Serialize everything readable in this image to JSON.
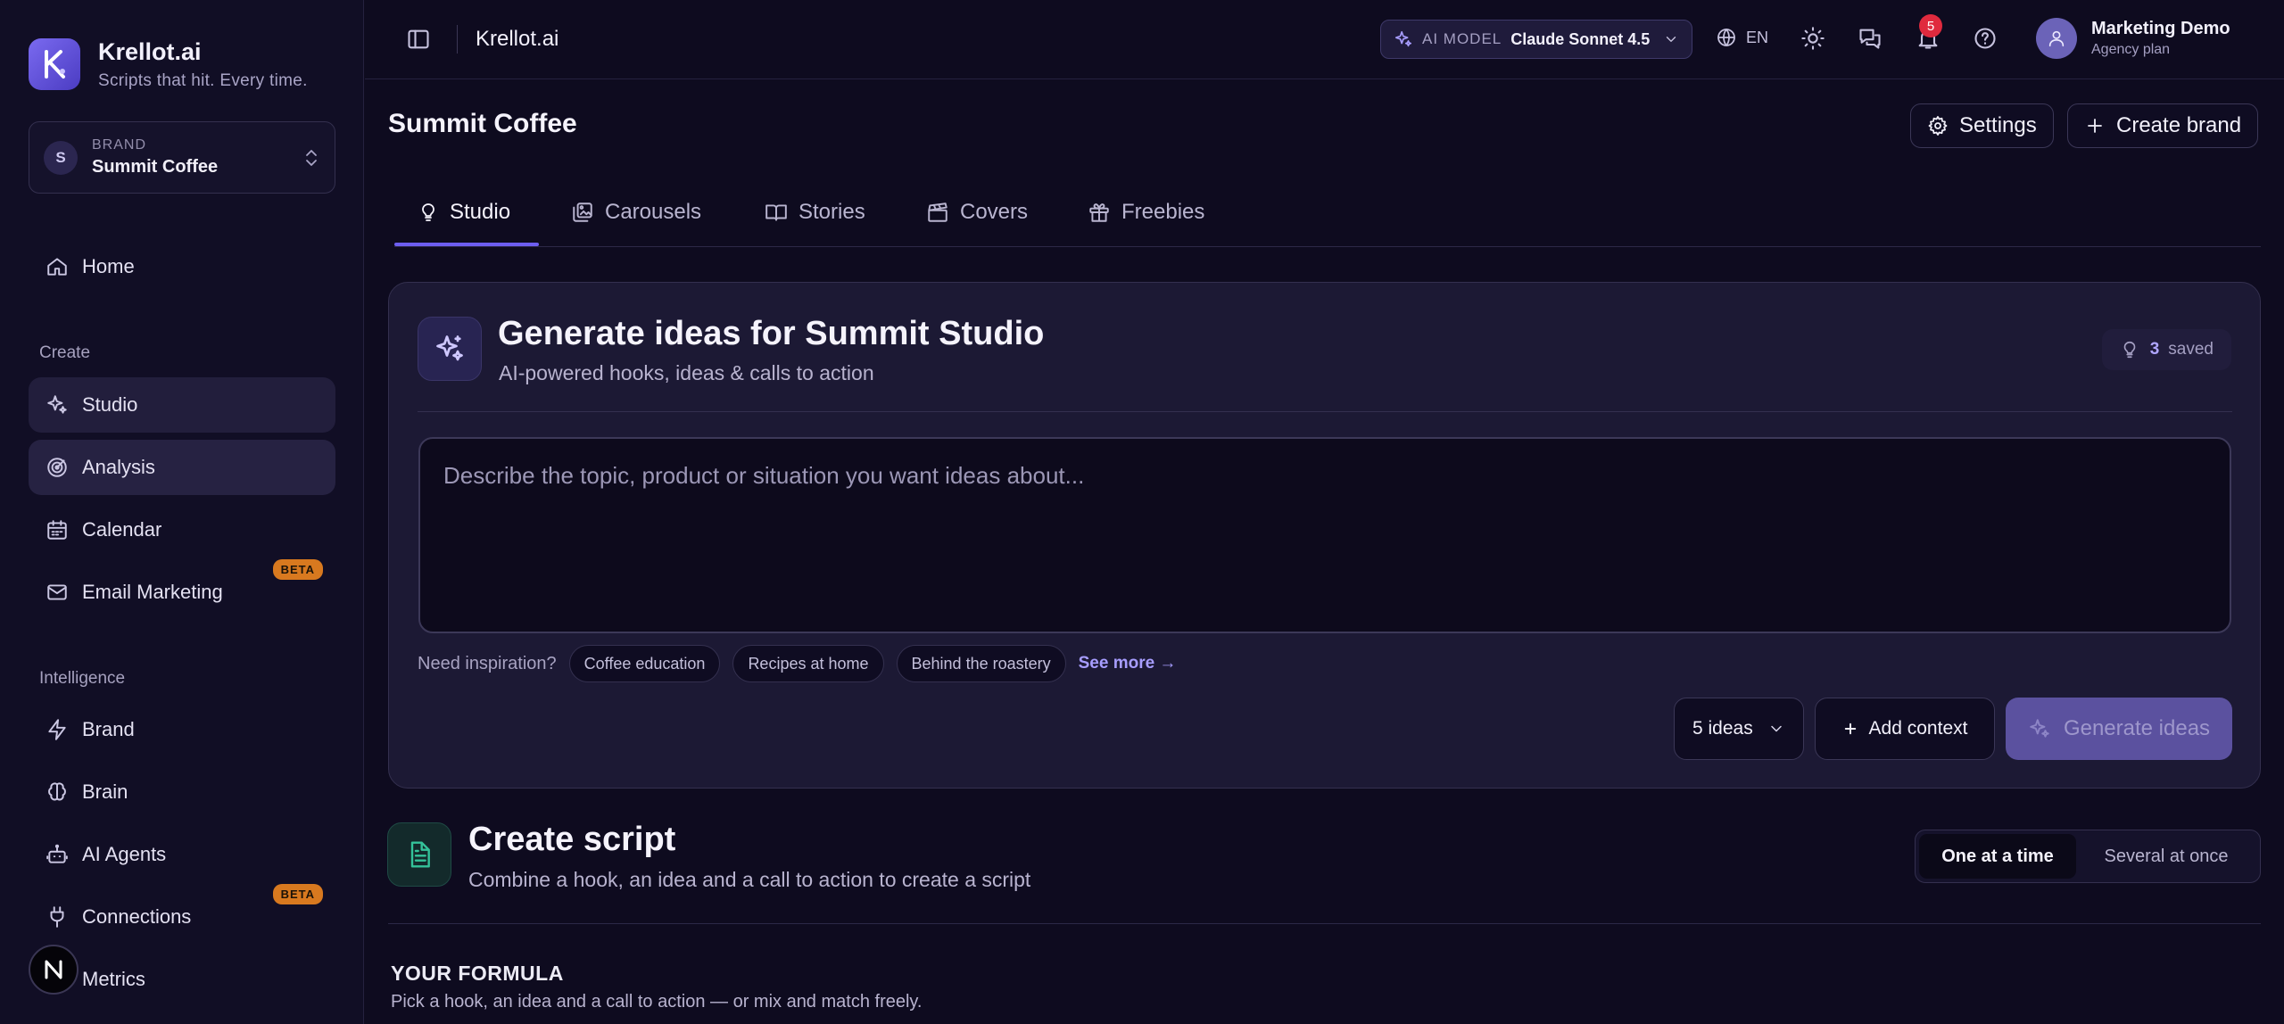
{
  "app": {
    "name": "Krellot.ai",
    "tagline": "Scripts that hit. Every time."
  },
  "brand_selector": {
    "initial": "S",
    "label": "BRAND",
    "value": "Summit Coffee"
  },
  "sidebar": {
    "home": "Home",
    "create_label": "Create",
    "studio": "Studio",
    "analysis": "Analysis",
    "calendar": "Calendar",
    "email_marketing": "Email Marketing",
    "beta": "BETA",
    "intelligence_label": "Intelligence",
    "brand": "Brand",
    "brain": "Brain",
    "ai_agents": "AI Agents",
    "connections": "Connections",
    "metrics": "Metrics"
  },
  "topbar": {
    "title": "Krellot.ai",
    "ai_model_label": "AI MODEL",
    "ai_model_value": "Claude Sonnet 4.5",
    "language": "EN",
    "notification_count": "5",
    "user_name": "Marketing Demo",
    "user_plan": "Agency plan"
  },
  "page": {
    "title": "Summit Coffee",
    "settings": "Settings",
    "create_brand": "Create brand"
  },
  "tabs": [
    "Studio",
    "Carousels",
    "Stories",
    "Covers",
    "Freebies"
  ],
  "ideas_card": {
    "title": "Generate ideas for Summit Studio",
    "subtitle": "AI-powered hooks, ideas & calls to action",
    "saved_count": "3",
    "saved_label": "saved",
    "placeholder": "Describe the topic, product or situation you want ideas about...",
    "inspiration_label": "Need inspiration?",
    "chips": [
      "Coffee education",
      "Recipes at home",
      "Behind the roastery"
    ],
    "see_more": "See more →",
    "count_value": "5 ideas",
    "add_context": "Add context",
    "generate": "Generate ideas"
  },
  "create_script": {
    "title": "Create script",
    "subtitle": "Combine a hook, an idea and a call to action to create a script",
    "mode_one": "One at a time",
    "mode_several": "Several at once",
    "formula_title": "YOUR FORMULA",
    "formula_sub": "Pick a hook, an idea and a call to action — or mix and match freely."
  },
  "colors": {
    "accent": "#6d5ef0",
    "beta_badge": "#d8791f",
    "notification": "#e02a3e",
    "script_icon": "#34c39a"
  }
}
